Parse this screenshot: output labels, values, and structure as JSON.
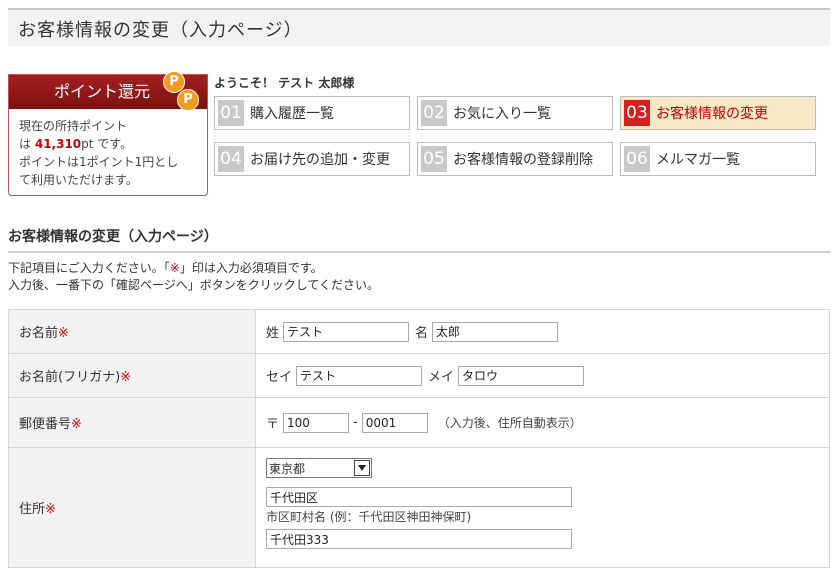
{
  "page_title": "お客様情報の変更（入力ページ）",
  "point_box": {
    "title": "ポイント還元",
    "badge_1": "P",
    "badge_2": "P",
    "line1": "現在の所持ポイント",
    "prefix": "は",
    "points": "41,310",
    "unit": "pt です。",
    "line3": "ポイントは1ポイント1円とし",
    "line4": "て利用いただけます。"
  },
  "welcome": "ようこそ！ テスト 太郎様",
  "menu": [
    {
      "num": "01",
      "label": "購入履歴一覧"
    },
    {
      "num": "02",
      "label": "お気に入り一覧"
    },
    {
      "num": "03",
      "label": "お客様情報の変更"
    },
    {
      "num": "04",
      "label": "お届け先の追加・変更"
    },
    {
      "num": "05",
      "label": "お客様情報の登録削除"
    },
    {
      "num": "06",
      "label": "メルマガ一覧"
    }
  ],
  "section_title": "お客様情報の変更（入力ページ）",
  "intro": {
    "line1_a": "下記項目にご入力ください。「",
    "line1_mark": "※",
    "line1_b": "」印は入力必須項目です。",
    "line2": "入力後、一番下の「確認ページへ」ボタンをクリックしてください。"
  },
  "required_mark": "※",
  "form": {
    "name": {
      "label": "お名前",
      "sei_label": "姓",
      "sei_value": "テスト",
      "mei_label": "名",
      "mei_value": "太郎"
    },
    "kana": {
      "label": "お名前(フリガナ)",
      "sei_label": "セイ",
      "sei_value": "テスト",
      "mei_label": "メイ",
      "mei_value": "タロウ"
    },
    "zip": {
      "label": "郵便番号",
      "mark": "〒",
      "zip1": "100",
      "dash": "-",
      "zip2": "0001",
      "note": "（入力後、住所自動表示）"
    },
    "address": {
      "label": "住所",
      "pref": "東京都",
      "city": "千代田区",
      "city_hint": "市区町村名 (例：千代田区神田神保町)",
      "street": "千代田333"
    }
  }
}
